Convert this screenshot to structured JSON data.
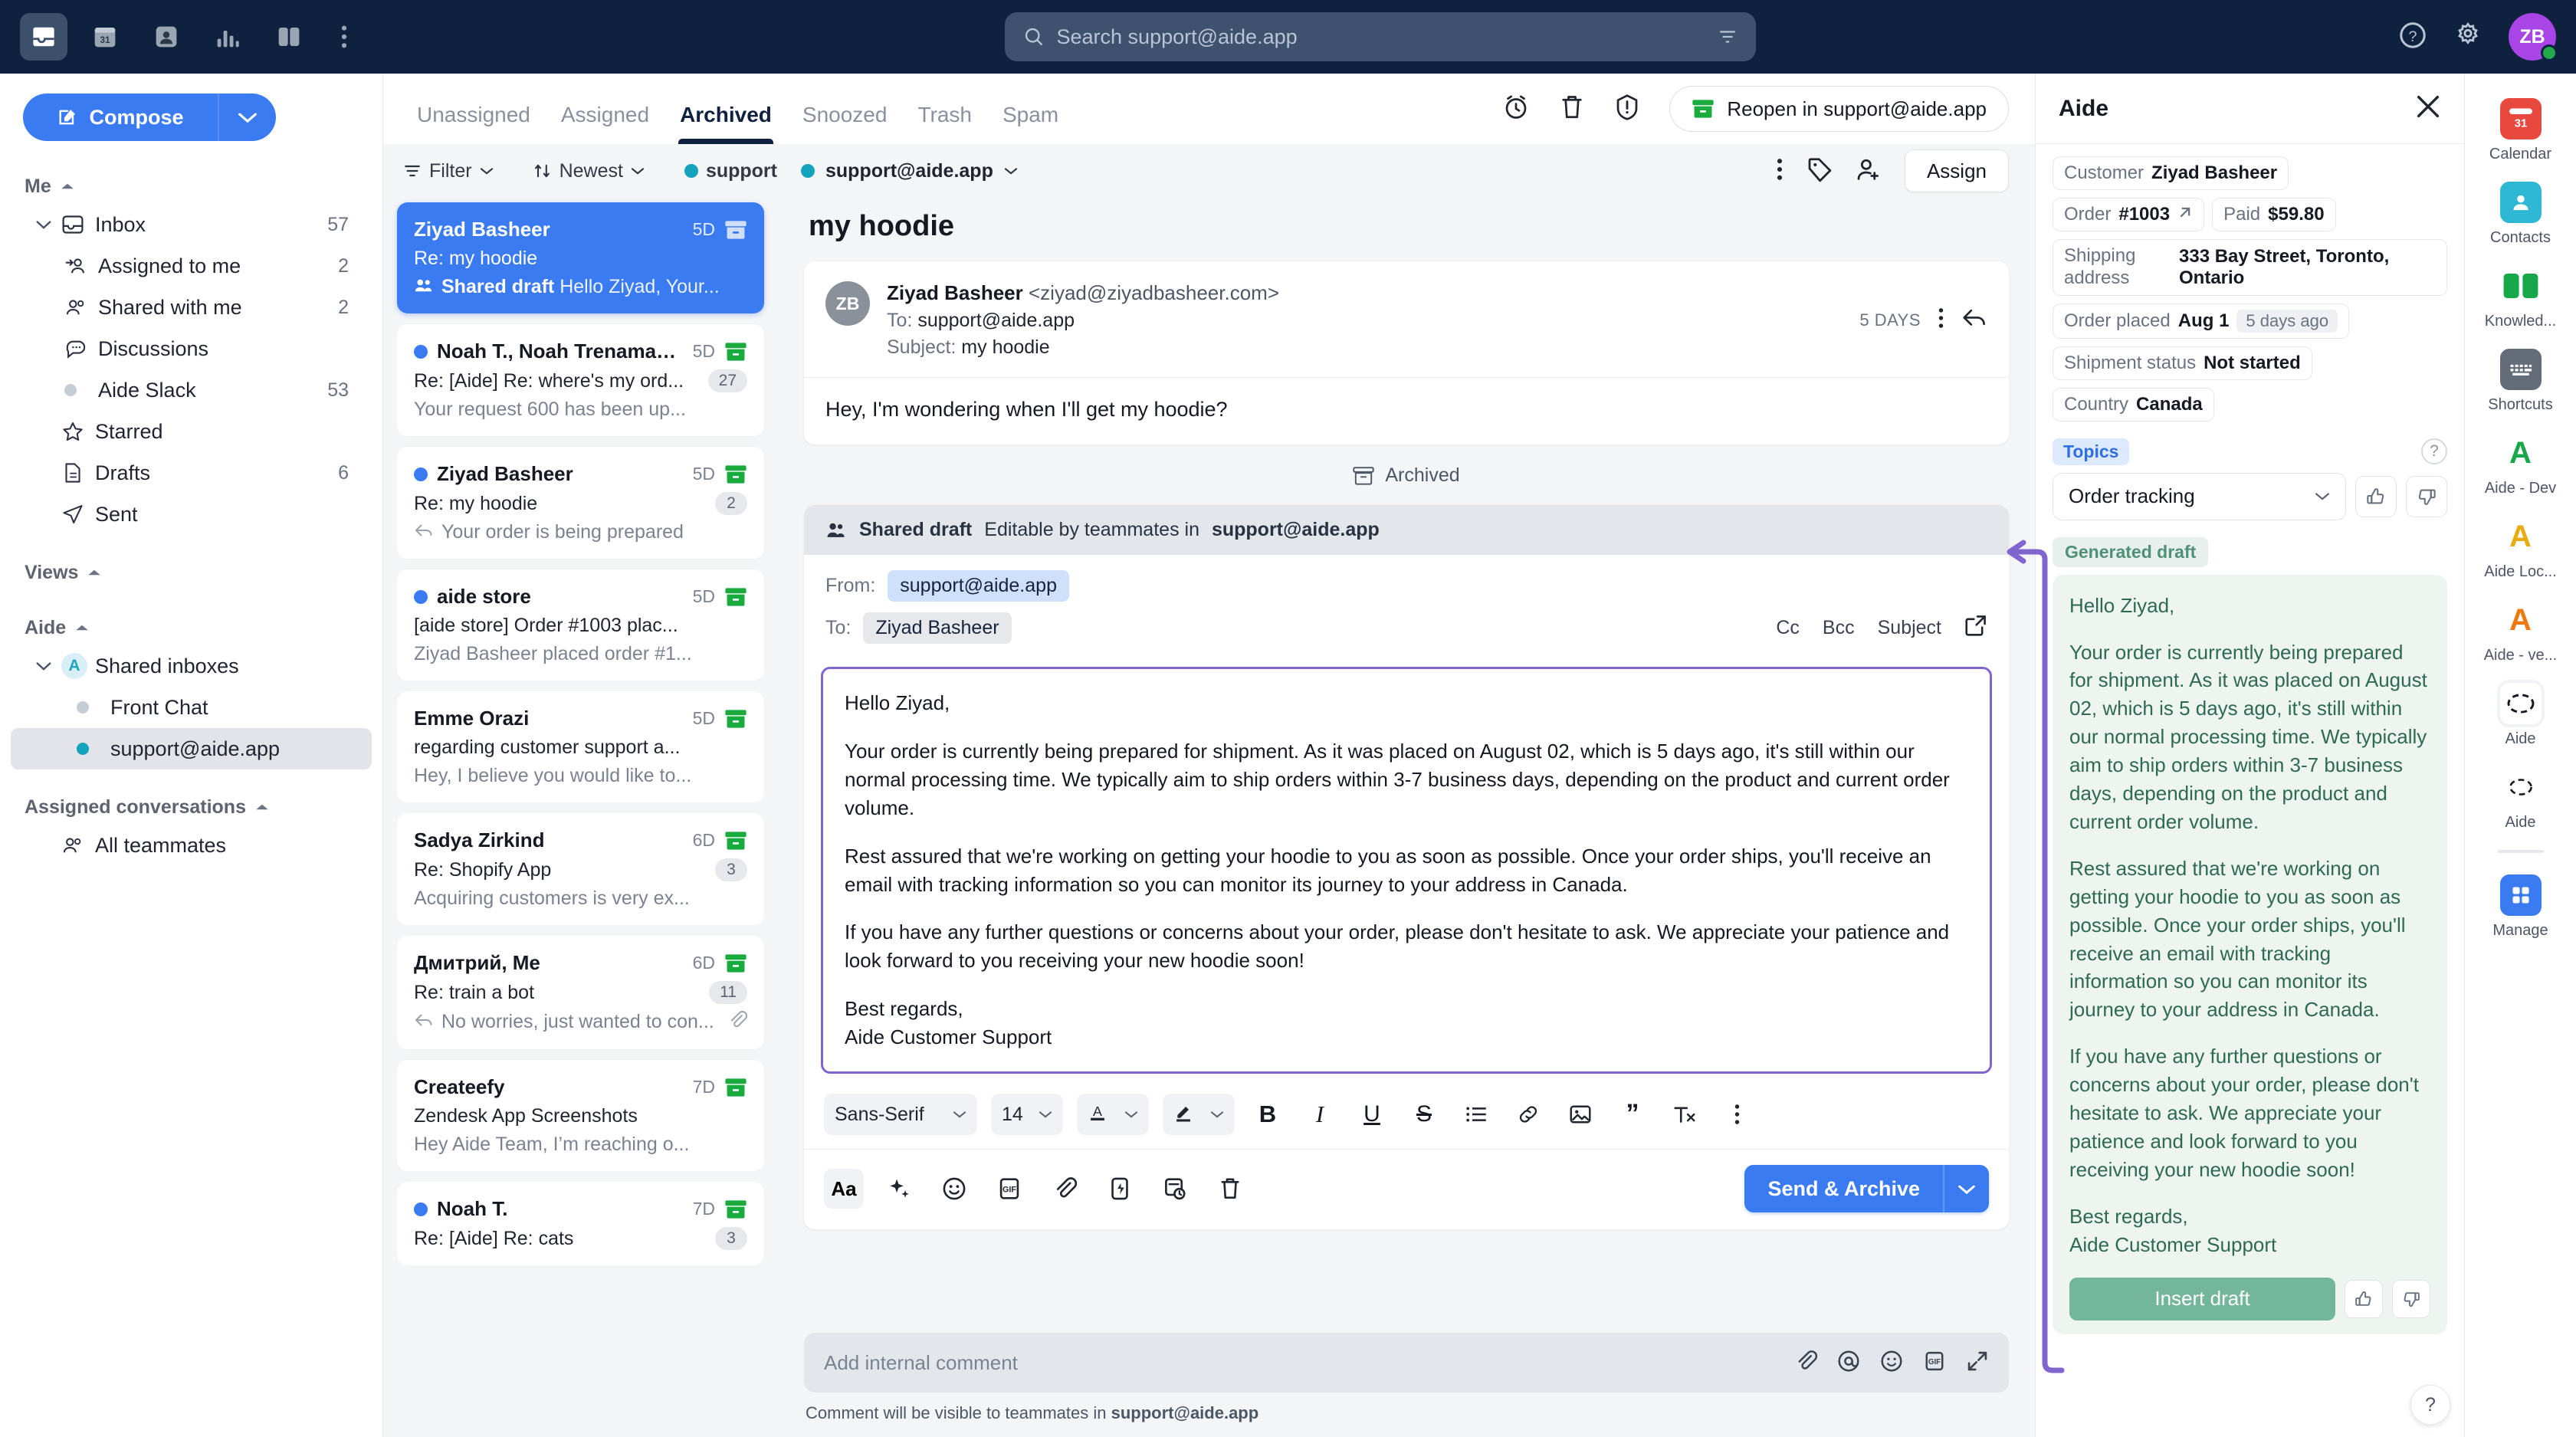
{
  "topbar": {
    "icons": [
      "inbox-icon",
      "calendar-icon",
      "contacts-icon",
      "analytics-icon",
      "knowledge-icon",
      "more-icon"
    ],
    "search": {
      "placeholder": "Search support@aide.app"
    },
    "avatar_initials": "ZB"
  },
  "sidebar": {
    "compose_label": "Compose",
    "groups": [
      {
        "label": "Me"
      },
      {
        "label": "Views"
      },
      {
        "label": "Aide"
      },
      {
        "label": "Assigned conversations"
      }
    ],
    "items": [
      {
        "label": "Inbox",
        "count": "57"
      },
      {
        "label": "Assigned to me",
        "count": "2"
      },
      {
        "label": "Shared with me",
        "count": "2"
      },
      {
        "label": "Discussions",
        "count": ""
      },
      {
        "label": "Aide Slack",
        "count": "53"
      },
      {
        "label": "Starred",
        "count": ""
      },
      {
        "label": "Drafts",
        "count": "6"
      },
      {
        "label": "Sent",
        "count": ""
      },
      {
        "label": "Shared inboxes",
        "count": ""
      },
      {
        "label": "Front Chat",
        "count": ""
      },
      {
        "label": "support@aide.app",
        "count": ""
      },
      {
        "label": "All teammates",
        "count": ""
      }
    ]
  },
  "list": {
    "tabs": [
      "Unassigned",
      "Assigned",
      "Archived",
      "Snoozed",
      "Trash",
      "Spam"
    ],
    "active_tab": "Archived",
    "filter_label": "Filter",
    "sort_label": "Newest",
    "inbox_label": "support@aide.app",
    "conversations": [
      {
        "name": "Ziyad Basheer",
        "time": "5D",
        "subject": "Re: my hoodie",
        "preview_prefix": "Shared draft",
        "preview": "Hello Ziyad, Your...",
        "badge": "",
        "unread": false,
        "selected": true,
        "prefix_icon": "people-icon",
        "archive_color": "#b9c4d4"
      },
      {
        "name": "Noah T., Noah Trenaman ...",
        "time": "5D",
        "subject": "Re: [Aide] Re: where's my ord...",
        "preview_prefix": "",
        "preview": "Your request 600 has been up...",
        "badge": "27",
        "unread": true,
        "selected": false,
        "prefix_icon": "",
        "archive_color": "#19ab3d"
      },
      {
        "name": "Ziyad Basheer",
        "time": "5D",
        "subject": "Re: my hoodie",
        "preview_prefix": "",
        "preview": "Your order is being prepared",
        "badge": "2",
        "unread": true,
        "selected": false,
        "prefix_icon": "reply-icon",
        "archive_color": "#19ab3d"
      },
      {
        "name": "aide store",
        "time": "5D",
        "subject": "[aide store] Order #1003 plac...",
        "preview_prefix": "",
        "preview": "Ziyad Basheer placed order #1...",
        "badge": "",
        "unread": true,
        "selected": false,
        "prefix_icon": "",
        "archive_color": "#19ab3d"
      },
      {
        "name": "Emme Orazi",
        "time": "5D",
        "subject": "regarding customer support a...",
        "preview_prefix": "",
        "preview": "Hey, I believe you would like to...",
        "badge": "",
        "unread": false,
        "selected": false,
        "prefix_icon": "",
        "archive_color": "#19ab3d"
      },
      {
        "name": "Sadya Zirkind",
        "time": "6D",
        "subject": "Re: Shopify App",
        "preview_prefix": "",
        "preview": "Acquiring customers is very ex...",
        "badge": "3",
        "unread": false,
        "selected": false,
        "prefix_icon": "",
        "archive_color": "#19ab3d"
      },
      {
        "name": "Дмитрий, Me",
        "time": "6D",
        "subject": "Re: train a bot",
        "preview_prefix": "",
        "preview": "No worries, just wanted to con...",
        "badge": "11",
        "unread": false,
        "selected": false,
        "prefix_icon": "reply-icon",
        "archive_color": "#19ab3d",
        "attachment": true
      },
      {
        "name": "Createefy",
        "time": "7D",
        "subject": "Zendesk App Screenshots",
        "preview_prefix": "",
        "preview": "Hey Aide Team, I’m reaching o...",
        "badge": "",
        "unread": false,
        "selected": false,
        "prefix_icon": "",
        "archive_color": "#19ab3d"
      },
      {
        "name": "Noah T.",
        "time": "7D",
        "subject": "Re: [Aide] Re: cats",
        "preview_prefix": "",
        "preview": "",
        "badge": "3",
        "unread": true,
        "selected": false,
        "prefix_icon": "",
        "archive_color": "#19ab3d"
      }
    ]
  },
  "thread": {
    "reopen_label": "Reopen in support@aide.app",
    "assign_label": "Assign",
    "title": "my hoodie",
    "message": {
      "avatar_initials": "ZB",
      "from_name": "Ziyad Basheer",
      "from_email": "<ziyad@ziyadbasheer.com>",
      "to_label": "To:",
      "to_value": "support@aide.app",
      "subject_label": "Subject:",
      "subject_value": "my hoodie",
      "age": "5 DAYS",
      "body": "Hey, I'm wondering when I'll get my hoodie?"
    },
    "archived_label": "Archived"
  },
  "composer": {
    "banner_title": "Shared draft",
    "banner_rest": "Editable by teammates in",
    "banner_inbox": "support@aide.app",
    "from_label": "From:",
    "from_value": "support@aide.app",
    "to_label": "To:",
    "to_value": "Ziyad Basheer",
    "actions": [
      "Cc",
      "Bcc",
      "Subject"
    ],
    "draft_paragraphs": [
      "Hello Ziyad,",
      "Your order is currently being prepared for shipment. As it was placed on August 02, which is 5 days ago, it's still within our normal processing time. We typically aim to ship orders within 3-7 business days, depending on the product and current order volume.",
      "Rest assured that we're working on getting your hoodie to you as soon as possible. Once your order ships, you'll receive an email with tracking information so you can monitor its journey to your address in Canada.",
      "If you have any further questions or concerns about your order, please don't hesitate to ask. We appreciate your patience and look forward to you receiving your new hoodie soon!",
      "Best regards,\nAide Customer Support"
    ],
    "font_family": "Sans-Serif",
    "font_size": "14",
    "send_label": "Send & Archive",
    "comment_placeholder": "Add internal comment",
    "comment_note_pre": "Comment will be visible to teammates in",
    "comment_note_inbox": "support@aide.app"
  },
  "aide": {
    "title": "Aide",
    "chips": [
      {
        "label": "Customer",
        "value": "Ziyad Basheer"
      },
      {
        "label": "Order",
        "value": "#1003",
        "external": true
      },
      {
        "label": "Paid",
        "value": "$59.80"
      },
      {
        "label": "Shipping address",
        "value": "333 Bay Street, Toronto, Ontario",
        "full": true
      },
      {
        "label": "Order placed",
        "value": "Aug 1",
        "sub": "5 days ago"
      },
      {
        "label": "Shipment status",
        "value": "Not started"
      },
      {
        "label": "Country",
        "value": "Canada"
      }
    ],
    "topics_label": "Topics",
    "topic_selected": "Order tracking",
    "generated_tag": "Generated draft",
    "generated_paragraphs": [
      "Hello Ziyad,",
      "Your order is currently being prepared for shipment. As it was placed on August 02, which is 5 days ago, it's still within our normal processing time. We typically aim to ship orders within 3-7 business days, depending on the product and current order volume.",
      "Rest assured that we're working on getting your hoodie to you as soon as possible. Once your order ships, you'll receive an email with tracking information so you can monitor its journey to your address in Canada.",
      "If you have any further questions or concerns about your order, please don't hesitate to ask. We appreciate your patience and look forward to you receiving your new hoodie soon!",
      "Best regards,\nAide Customer Support"
    ],
    "insert_label": "Insert draft",
    "help_label": "?"
  },
  "rail": {
    "items": [
      {
        "label": "Calendar",
        "icon": "calendar-icon",
        "color": "#e8493f",
        "kind": "box",
        "glyph": "31"
      },
      {
        "label": "Contacts",
        "icon": "contacts-icon",
        "color": "#2eb8d4",
        "kind": "box",
        "glyph": "●"
      },
      {
        "label": "Knowled...",
        "icon": "knowledge-icon",
        "color": "#17a84a",
        "kind": "book",
        "glyph": ""
      },
      {
        "label": "Shortcuts",
        "icon": "keyboard-icon",
        "color": "#646c78",
        "kind": "box",
        "glyph": "⌨"
      },
      {
        "label": "Aide - Dev",
        "icon": "aide-dev-icon",
        "color": "#17a84a",
        "kind": "letter",
        "glyph": "A"
      },
      {
        "label": "Aide Loc...",
        "icon": "aide-local-icon",
        "color": "#e8ab10",
        "kind": "letter",
        "glyph": "A"
      },
      {
        "label": "Aide - ve...",
        "icon": "aide-ve-icon",
        "color": "#f07810",
        "kind": "letter",
        "glyph": "A"
      },
      {
        "label": "Aide",
        "icon": "aide-circle-icon",
        "color": "#141922",
        "kind": "dashed",
        "glyph": "",
        "selected": true
      },
      {
        "label": "Aide",
        "icon": "aide-circle-icon",
        "color": "#141922",
        "kind": "dashed",
        "glyph": ""
      },
      {
        "label": "Manage",
        "icon": "manage-icon",
        "color": "#3b7bf2",
        "kind": "grid",
        "glyph": ""
      }
    ]
  },
  "colors": {
    "brand_blue": "#3b7bf2",
    "navy": "#0e2240",
    "green": "#19ab3d",
    "purple_outline": "#8165cf",
    "aide_green": "#74b69b"
  }
}
